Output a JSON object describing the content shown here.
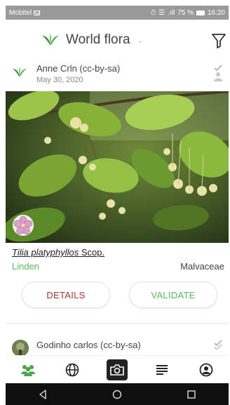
{
  "status_bar": {
    "carrier": "Mobitel",
    "signal_text": ".ıll",
    "battery_percent": "75 %",
    "time": "16:20"
  },
  "header": {
    "title": "World flora",
    "icons": {
      "logo": "leaf-logo-icon",
      "dropdown": "chevron-down-icon",
      "filter": "filter-icon"
    }
  },
  "observation": {
    "author": "Anne Crln (cc-by-sa)",
    "date": "May 30, 2020",
    "scientific_name": "Tilia platyphyllos",
    "author_abbrev": "Scop.",
    "common_name": "Linden",
    "family": "Malvaceae",
    "organ_icon": "flower-icon"
  },
  "actions": {
    "details_label": "DETAILS",
    "validate_label": "VALIDATE"
  },
  "next_observation": {
    "author": "Godinho carlos (cc-by-sa)"
  },
  "bottom_nav": {
    "items": [
      "community-icon",
      "globe-icon",
      "camera-icon",
      "list-icon",
      "profile-icon"
    ]
  },
  "colors": {
    "accent_green": "#5cb85c",
    "details_red": "#b2323a",
    "statusbar_gray": "#9a9a9a",
    "nav_black": "#0f0f0f"
  }
}
